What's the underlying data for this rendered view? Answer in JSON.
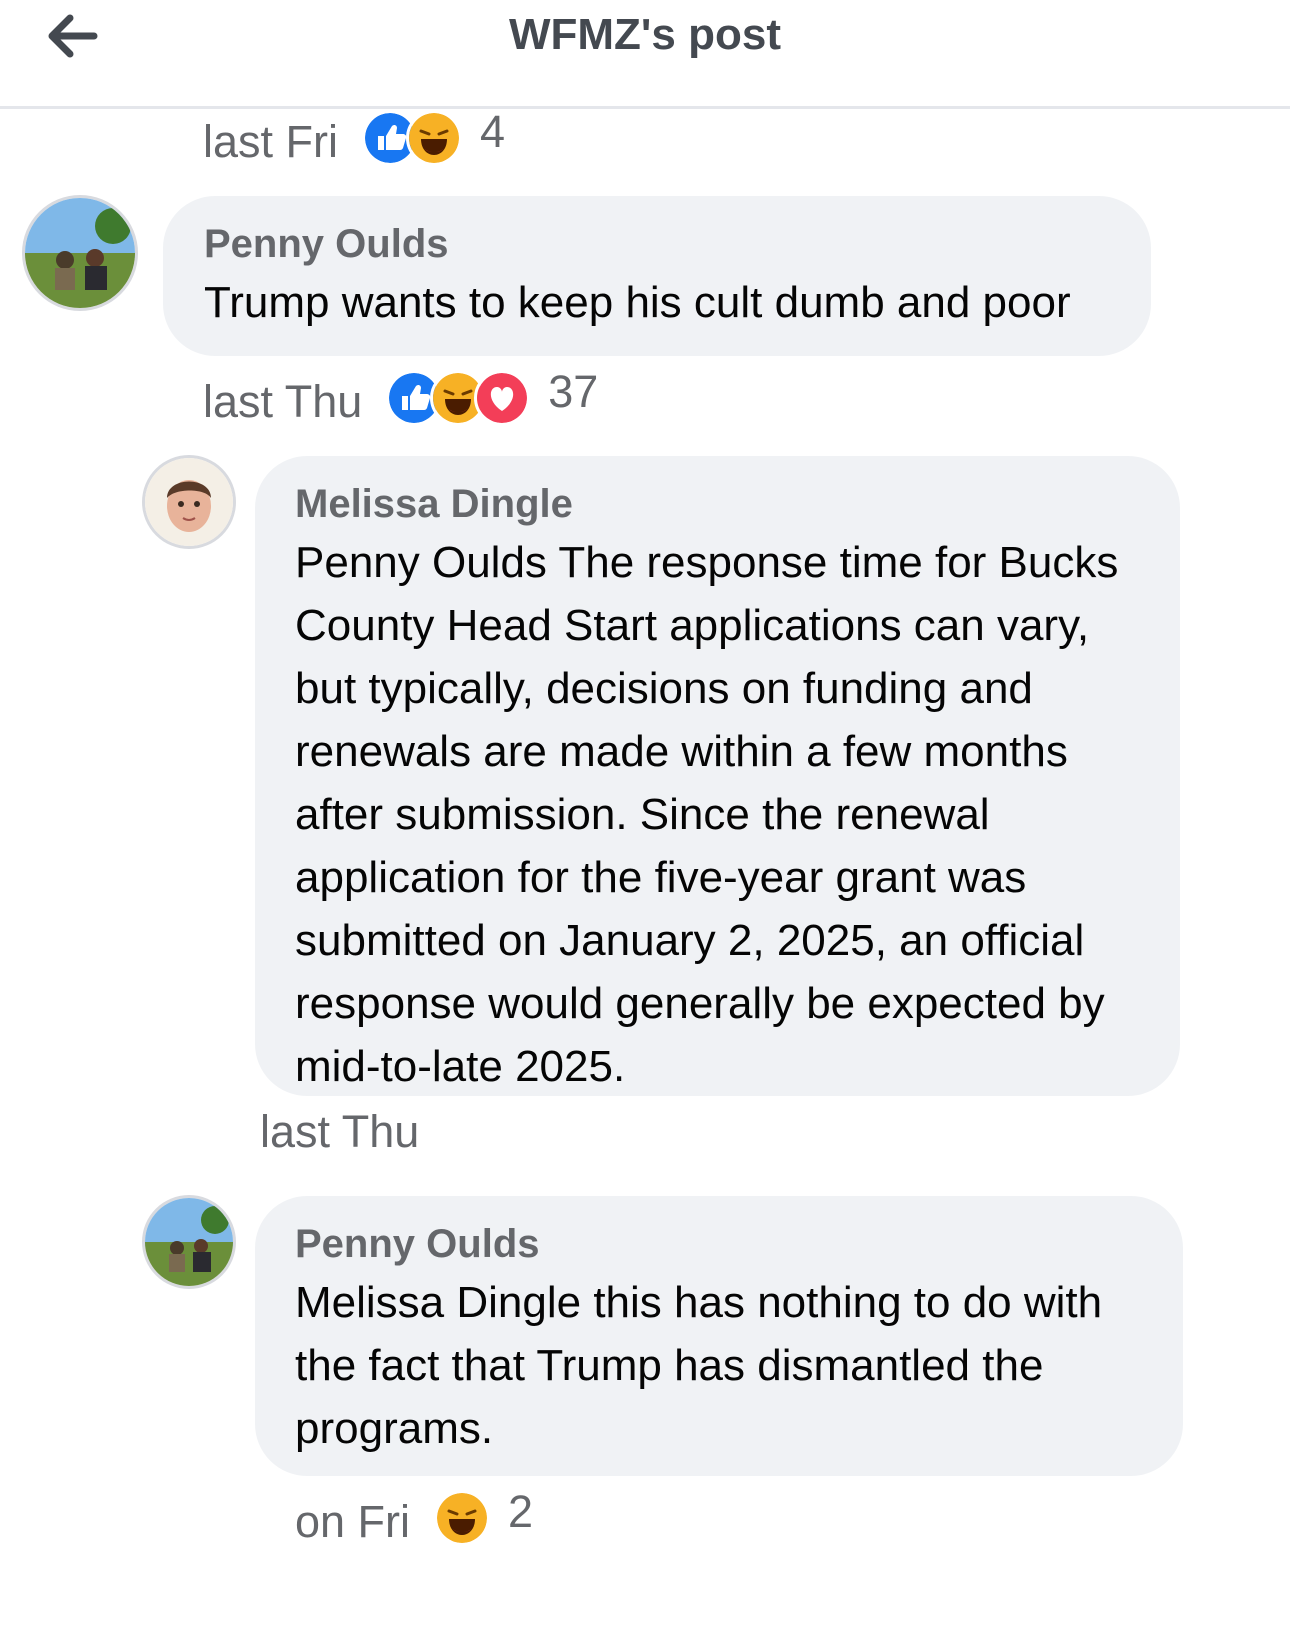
{
  "header": {
    "title": "WFMZ's post",
    "back_icon": "arrow-left-icon"
  },
  "comments": [
    {
      "id": "c0",
      "meta": {
        "time": "last Fri",
        "reactions": [
          "like",
          "haha"
        ],
        "count": "4"
      }
    },
    {
      "id": "c1",
      "author": "Penny Oulds",
      "text": "Trump wants to keep his cult dumb and poor",
      "meta": {
        "time": "last Thu",
        "reactions": [
          "like",
          "haha",
          "love"
        ],
        "count": "37"
      }
    },
    {
      "id": "c2",
      "author": "Melissa Dingle",
      "text": "Penny Oulds The response time for Bucks County Head Start applications can vary, but typically, decisions on funding and renewals are made within a few months after submission. Since the renewal application for the five-year grant was submitted on January 2, 2025, an official response would generally be expected by mid-to-late 2025.",
      "meta": {
        "time": "last Thu"
      }
    },
    {
      "id": "c3",
      "author": "Penny Oulds",
      "text": "Melissa Dingle this has nothing to do with the fact that Trump has dismantled the programs.",
      "meta": {
        "time": "on Fri",
        "reactions": [
          "haha"
        ],
        "count": "2"
      }
    }
  ],
  "colors": {
    "like": "#1877f2",
    "love": "#f33e58",
    "haha": "#f7b125",
    "meta": "#65676b",
    "bubble": "#f0f2f5"
  }
}
